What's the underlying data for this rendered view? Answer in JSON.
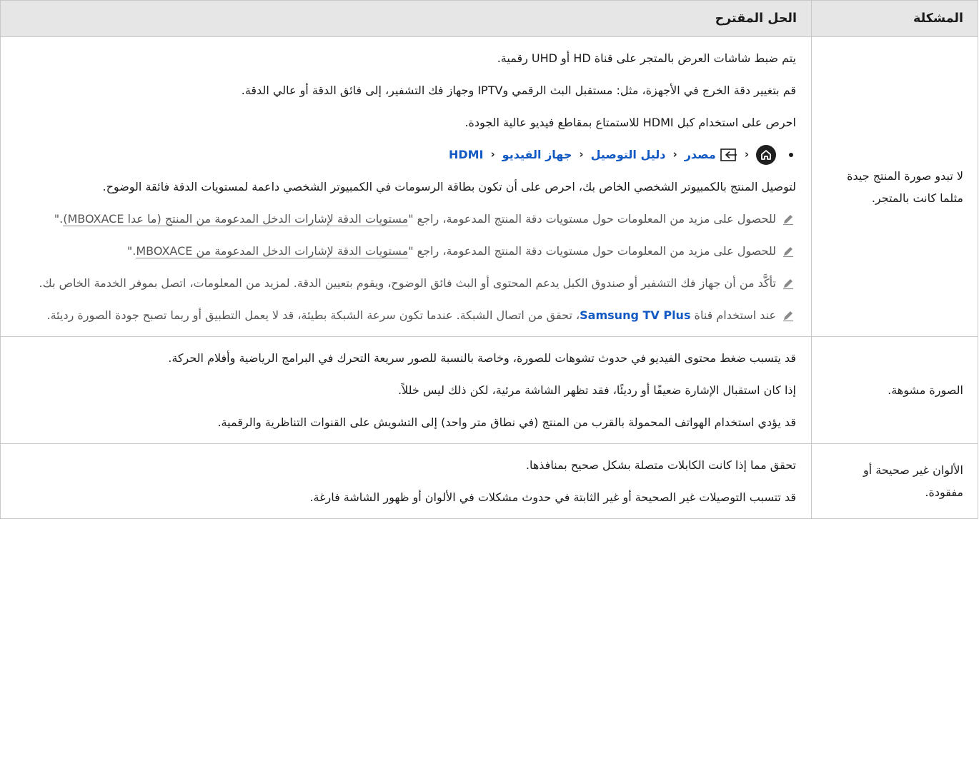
{
  "header": {
    "problem": "المشكلة",
    "solution": "الحل المقترح"
  },
  "row1": {
    "problem": "لا تبدو صورة المنتج جيدة مثلما كانت بالمتجر.",
    "p1": "يتم ضبط شاشات العرض بالمتجر على قناة HD أو UHD رقمية.",
    "p2": "قم بتغيير دقة الخرج في الأجهزة، مثل: مستقبل البث الرقمي وIPTV وجهاز فك التشفير، إلى فائق الدقة أو عالي الدقة.",
    "p3": "احرص على استخدام كبل HDMI للاستمتاع بمقاطع فيديو عالية الجودة.",
    "path": {
      "source": "مصدر",
      "guide": "دليل التوصيل",
      "video_device": "جهاز الفيديو",
      "hdmi": "HDMI",
      "sep": "‹"
    },
    "p4": "لتوصيل المنتج بالكمبيوتر الشخصي الخاص بك، احرص على أن تكون بطاقة الرسومات في الكمبيوتر الشخصي داعمة لمستويات الدقة فائقة الوضوح.",
    "note1_prefix": "للحصول على مزيد من المعلومات حول مستويات دقة المنتج المدعومة، راجع \"",
    "note1_link": "مستويات الدقة لإشارات الدخل المدعومة من المنتج (ما عدا MBOXACE)",
    "note1_suffix": ".\"",
    "note2_prefix": "للحصول على مزيد من المعلومات حول مستويات دقة المنتج المدعومة، راجع \"",
    "note2_link": "مستويات الدقة لإشارات الدخل المدعومة من MBOXACE",
    "note2_suffix": ".\"",
    "note3": "تأكَّد من أن جهاز فك التشفير أو صندوق الكبل يدعم المحتوى أو البث فائق الوضوح، ويقوم بتعيين الدقة. لمزيد من المعلومات، اتصل بموفر الخدمة الخاص بك.",
    "note4_prefix": "عند استخدام قناة ",
    "note4_brand": "Samsung TV Plus",
    "note4_suffix": "، تحقق من اتصال الشبكة. عندما تكون سرعة الشبكة بطيئة، قد لا يعمل التطبيق أو ربما تصبح جودة الصورة رديئة."
  },
  "row2": {
    "problem": "الصورة مشوهة.",
    "p1": "قد يتسبب ضغط محتوى الفيديو في حدوث تشوهات للصورة، وخاصة بالنسبة للصور سريعة التحرك في البرامج الرياضية وأفلام الحركة.",
    "p2": "إذا كان استقبال الإشارة ضعيفًا أو رديئًا، فقد تظهر الشاشة مرئية، لكن ذلك ليس خللاً.",
    "p3": "قد يؤدي استخدام الهواتف المحمولة بالقرب من المنتج (في نطاق متر واحد) إلى التشويش على القنوات التناظرية والرقمية."
  },
  "row3": {
    "problem": "الألوان غير صحيحة أو مفقودة.",
    "p1": "تحقق مما إذا كانت الكابلات متصلة بشكل صحيح بمنافذها.",
    "p2": "قد تتسبب التوصيلات غير الصحيحة أو غير الثابتة في حدوث مشكلات في الألوان أو ظهور الشاشة فارغة."
  },
  "colors": {
    "header_bg": "#e6e6e6",
    "border": "#c9c9c9",
    "link_blue": "#1259c3",
    "note_gray": "#555555"
  },
  "icons": {
    "home": "home-icon",
    "source": "source-input-icon",
    "note": "pencil-icon",
    "chevron": "chevron-left-icon"
  }
}
